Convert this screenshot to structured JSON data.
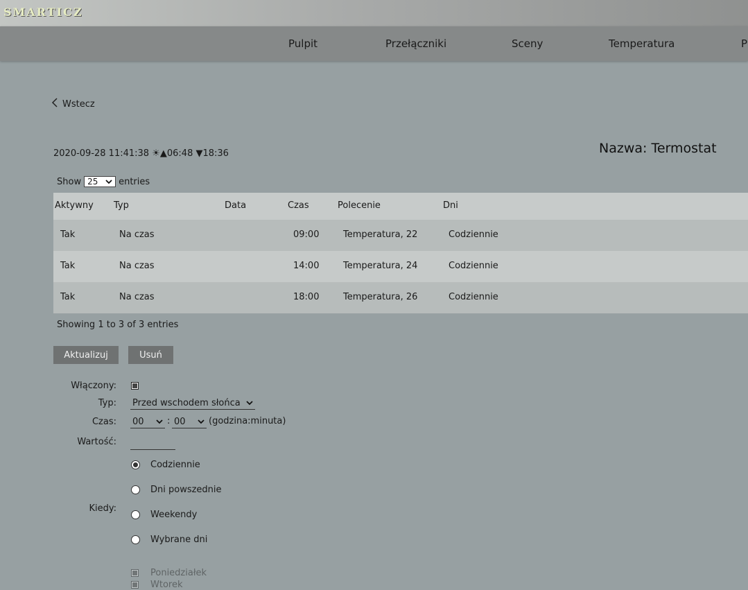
{
  "app": {
    "logo": "SMARTICZ"
  },
  "nav": {
    "items": [
      "Pulpit",
      "Przełączniki",
      "Sceny",
      "Temperatura",
      "P"
    ]
  },
  "back": {
    "label": "Wstecz"
  },
  "status": {
    "datetime": "2020-09-28 11:41:38",
    "sunrise": "06:48",
    "sunset": "18:36"
  },
  "device": {
    "title": "Nazwa: Termostat"
  },
  "table": {
    "show_label": "Show",
    "entries_value": "25",
    "entries_label": "entries",
    "columns": [
      "Aktywny",
      "Typ",
      "Data",
      "Czas",
      "Polecenie",
      "Dni"
    ],
    "rows": [
      {
        "aktywny": "Tak",
        "typ": "Na czas",
        "data": "",
        "czas": "09:00",
        "polecenie": "Temperatura, 22",
        "dni": "Codziennie"
      },
      {
        "aktywny": "Tak",
        "typ": "Na czas",
        "data": "",
        "czas": "14:00",
        "polecenie": "Temperatura, 24",
        "dni": "Codziennie"
      },
      {
        "aktywny": "Tak",
        "typ": "Na czas",
        "data": "",
        "czas": "18:00",
        "polecenie": "Temperatura, 26",
        "dni": "Codziennie"
      }
    ],
    "info": "Showing 1 to 3 of 3 entries"
  },
  "buttons": {
    "update": "Aktualizuj",
    "delete": "Usuń"
  },
  "form": {
    "enabled_label": "Włączony:",
    "type_label": "Typ:",
    "type_value": "Przed wschodem słońca",
    "time_label": "Czas:",
    "hour_value": "00",
    "time_sep": ":",
    "minute_value": "00",
    "time_hint": "(godzina:minuta)",
    "value_label": "Wartość:",
    "when_label": "Kiedy:",
    "when_options": [
      "Codziennie",
      "Dni powszednie",
      "Weekendy",
      "Wybrane dni"
    ],
    "when_selected": "Codziennie",
    "days": [
      "Poniedziałek",
      "Wtorek"
    ]
  }
}
